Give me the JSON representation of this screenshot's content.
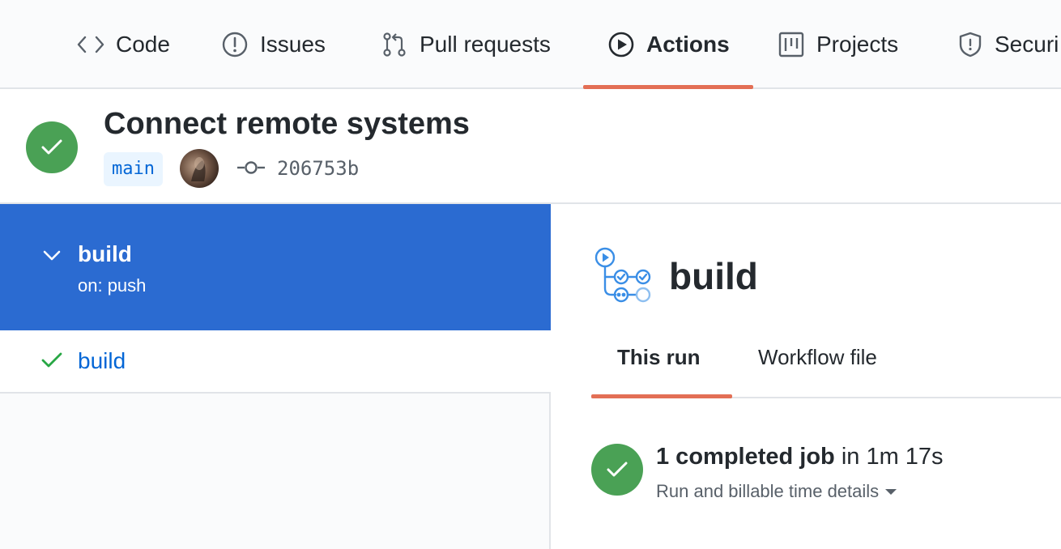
{
  "nav": {
    "tabs": [
      {
        "label": "Code",
        "icon": "code-icon"
      },
      {
        "label": "Issues",
        "icon": "issue-icon"
      },
      {
        "label": "Pull requests",
        "icon": "pull-request-icon"
      },
      {
        "label": "Actions",
        "icon": "play-icon",
        "selected": true
      },
      {
        "label": "Projects",
        "icon": "project-icon"
      },
      {
        "label": "Securi",
        "icon": "shield-icon"
      }
    ]
  },
  "run": {
    "title": "Connect remote systems",
    "branch": "main",
    "commit_sha": "206753b",
    "status": "success"
  },
  "sidebar": {
    "workflow": {
      "name": "build",
      "trigger": "on: push"
    },
    "jobs": [
      {
        "name": "build",
        "status": "success"
      }
    ]
  },
  "main": {
    "title": "build",
    "tabs": [
      {
        "label": "This run",
        "selected": true
      },
      {
        "label": "Workflow file"
      }
    ],
    "summary": {
      "completed": "1 completed job",
      "duration": " in 1m 17s",
      "details": "Run and billable time details"
    }
  },
  "colors": {
    "success": "#4aa155",
    "accent_underline": "#e36f55",
    "selected_bg": "#2b6bd1",
    "link": "#0366d6"
  }
}
